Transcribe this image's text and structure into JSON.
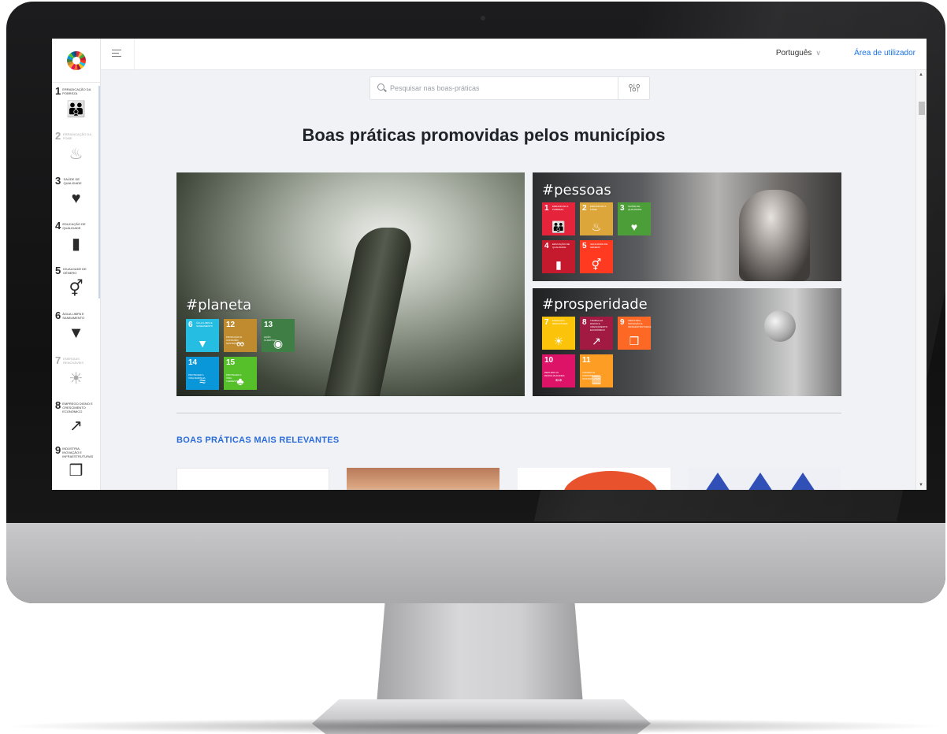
{
  "topbar": {
    "language": "Português",
    "user_area": "Área de utilizador"
  },
  "search": {
    "placeholder": "Pesquisar nas boas-práticas"
  },
  "page": {
    "title": "Boas práticas promovidas pelos municípios"
  },
  "sidebar": {
    "goals": [
      {
        "num": "1",
        "name": "Erradicação da pobreza",
        "icon": "people-icon",
        "glyph": "👪"
      },
      {
        "num": "2",
        "name": "Erradicação da fome",
        "icon": "food-bowl-icon",
        "glyph": "♨"
      },
      {
        "num": "3",
        "name": "Saúde de qualidade",
        "icon": "heartbeat-icon",
        "glyph": "♥"
      },
      {
        "num": "4",
        "name": "Educação de qualidade",
        "icon": "book-icon",
        "glyph": "▮"
      },
      {
        "num": "5",
        "name": "Igualdade de género",
        "icon": "gender-icon",
        "glyph": "⚥"
      },
      {
        "num": "6",
        "name": "Água limpa e saneamento",
        "icon": "water-icon",
        "glyph": "▼"
      },
      {
        "num": "7",
        "name": "Energias renováveis",
        "icon": "sun-icon",
        "glyph": "☀"
      },
      {
        "num": "8",
        "name": "Emprego digno e crescimento económico",
        "icon": "growth-chart-icon",
        "glyph": "↗"
      },
      {
        "num": "9",
        "name": "Indústria, inovação e infraestruturas",
        "icon": "cubes-icon",
        "glyph": "❒"
      }
    ]
  },
  "pillars": {
    "planeta": {
      "label": "#planeta",
      "tiles": [
        {
          "num": "6",
          "text": "Água limpa e saneamento",
          "color": "#26bde2",
          "glyph": "▼"
        },
        {
          "num": "12",
          "text": "Produção e consumo sustentáveis",
          "color": "#bf8b2e",
          "glyph": "∞"
        },
        {
          "num": "13",
          "text": "Ação climática",
          "color": "#3f7e44",
          "glyph": "◉"
        },
        {
          "num": "14",
          "text": "Proteger a vida marinha",
          "color": "#0a97d9",
          "glyph": "≈"
        },
        {
          "num": "15",
          "text": "Proteger a vida terrestre",
          "color": "#56c02b",
          "glyph": "♣"
        }
      ]
    },
    "pessoas": {
      "label": "#pessoas",
      "tiles": [
        {
          "num": "1",
          "text": "Erradicar a pobreza",
          "color": "#e5243b",
          "glyph": "👪"
        },
        {
          "num": "2",
          "text": "Erradicar a fome",
          "color": "#dda63a",
          "glyph": "♨"
        },
        {
          "num": "3",
          "text": "Saúde de qualidade",
          "color": "#4c9f38",
          "glyph": "♥"
        },
        {
          "num": "4",
          "text": "Educação de qualidade",
          "color": "#c5192d",
          "glyph": "▮"
        },
        {
          "num": "5",
          "text": "Igualdade de género",
          "color": "#ff3a21",
          "glyph": "⚥"
        }
      ]
    },
    "prosperidade": {
      "label": "#prosperidade",
      "tiles": [
        {
          "num": "7",
          "text": "Energias renováveis",
          "color": "#fcc30b",
          "glyph": "☀"
        },
        {
          "num": "8",
          "text": "Trabalho digno e crescimento económico",
          "color": "#a21942",
          "glyph": "↗"
        },
        {
          "num": "9",
          "text": "Indústria, inovação e infraestruturas",
          "color": "#fd6925",
          "glyph": "❒"
        },
        {
          "num": "10",
          "text": "Reduzir as desigualdades",
          "color": "#dd1367",
          "glyph": "⇔"
        },
        {
          "num": "11",
          "text": "Cidades e comunidades sustentáveis",
          "color": "#fd9d24",
          "glyph": "▥"
        }
      ]
    }
  },
  "relevant": {
    "heading": "BOAS PRÁTICAS MAIS RELEVANTES"
  }
}
